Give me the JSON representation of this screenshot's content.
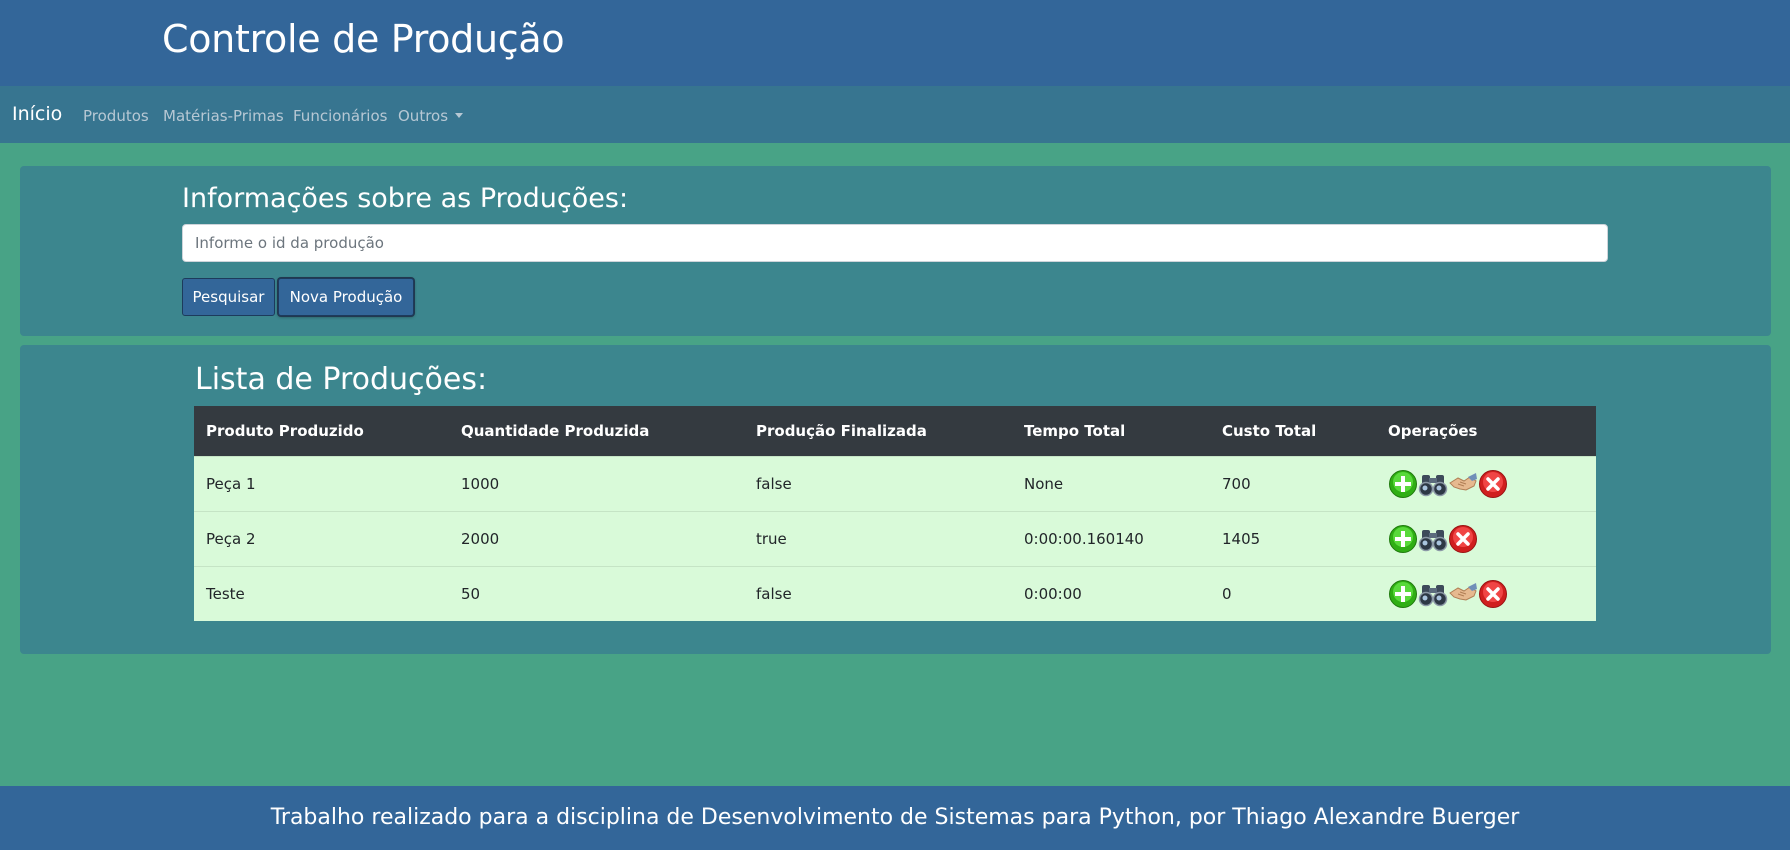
{
  "header": {
    "title": "Controle de Produção"
  },
  "navbar": {
    "brand": "Início",
    "links": [
      "Produtos",
      "Matérias-Primas",
      "Funcionários",
      "Outros"
    ]
  },
  "search": {
    "heading": "Informações sobre as Produções:",
    "placeholder": "Informe o id da produção",
    "value": "",
    "search_button": "Pesquisar",
    "new_button": "Nova Produção"
  },
  "list": {
    "heading": "Lista de Produções:",
    "columns": [
      "Produto Produzido",
      "Quantidade Produzida",
      "Produção Finalizada",
      "Tempo Total",
      "Custo Total",
      "Operações"
    ],
    "rows": [
      {
        "produto": "Peça 1",
        "quantidade": "1000",
        "finalizada": "false",
        "tempo": "None",
        "custo": "700",
        "ops": [
          "add-icon",
          "binoculars-icon",
          "handshake-icon",
          "delete-icon"
        ]
      },
      {
        "produto": "Peça 2",
        "quantidade": "2000",
        "finalizada": "true",
        "tempo": "0:00:00.160140",
        "custo": "1405",
        "ops": [
          "add-icon",
          "binoculars-icon",
          "delete-icon"
        ]
      },
      {
        "produto": "Teste",
        "quantidade": "50",
        "finalizada": "false",
        "tempo": "0:00:00",
        "custo": "0",
        "ops": [
          "add-icon",
          "binoculars-icon",
          "handshake-icon",
          "delete-icon"
        ]
      }
    ]
  },
  "footer": {
    "text": "Trabalho realizado para a disciplina de Desenvolvimento de Sistemas para Python, por Thiago Alexandre Buerger"
  },
  "colors": {
    "header_bg": "#336699",
    "navbar_bg": "#377590",
    "page_bg": "#48a386",
    "panel_bg": "#3c868e",
    "table_head_bg": "#343a40",
    "table_row_bg": "#d9fad9",
    "add_icon": "#3cc31a",
    "delete_icon": "#e52b2b"
  }
}
